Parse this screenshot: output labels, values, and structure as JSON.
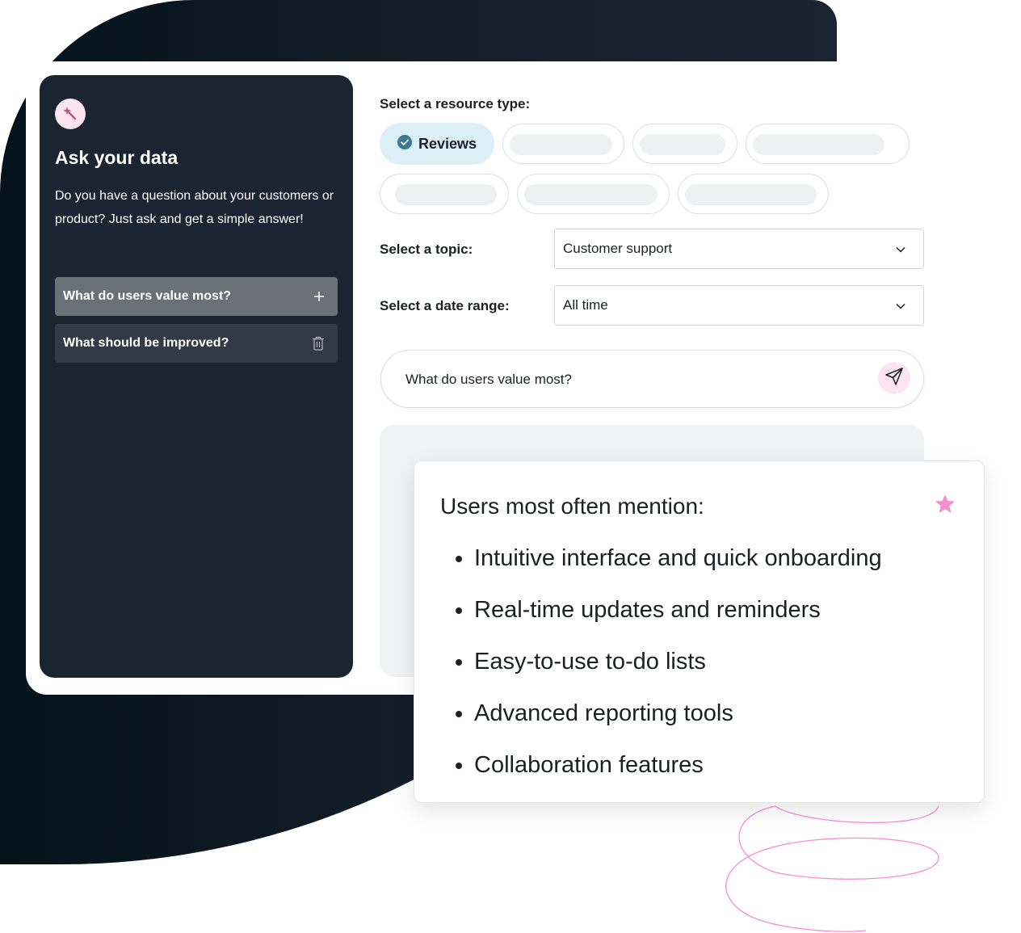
{
  "colors": {
    "background_dark": "#1b2531",
    "accent_pink": "#f48fcf",
    "accent_pink_light": "#fce4f0",
    "chip_active": "#ddeff6",
    "check_teal": "#3b7a92"
  },
  "sidebar": {
    "icon": "magic-wand-icon",
    "title": "Ask your data",
    "description": "Do you have a question about your customers or product? Just ask and get a simple answer!",
    "questions": [
      {
        "label": "What do users value most?",
        "icon": "plus-icon"
      },
      {
        "label": "What should be improved?",
        "icon": "trash-icon"
      }
    ]
  },
  "main": {
    "resource_type_label": "Select a resource type:",
    "resource_chips": [
      {
        "label": "Reviews",
        "selected": true,
        "icon": "check-circle-icon"
      }
    ],
    "topic": {
      "label": "Select a topic:",
      "value": "Customer support",
      "icon": "chevron-down-icon"
    },
    "date_range": {
      "label": "Select a date range:",
      "value": "All time",
      "icon": "chevron-down-icon"
    },
    "question_input": {
      "value": "What do users value most?",
      "send_icon": "send-icon"
    }
  },
  "answer": {
    "title": "Users most often mention:",
    "icon": "star-icon",
    "items": [
      "Intuitive interface and quick onboarding",
      "Real-time updates and reminders",
      "Easy-to-use to-do lists",
      "Advanced reporting tools",
      "Collaboration features"
    ]
  }
}
